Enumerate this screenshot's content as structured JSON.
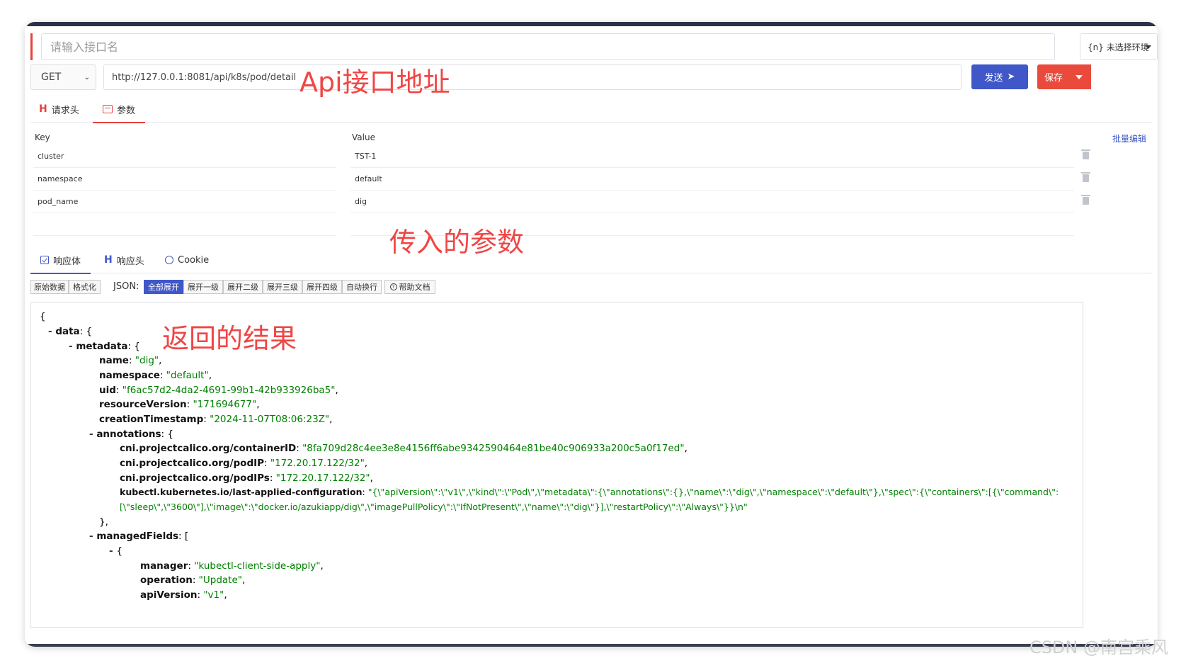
{
  "request": {
    "name_placeholder": "请输入接口名",
    "env_label": "{n} 未选择环境",
    "method": "GET",
    "url": "http://127.0.0.1:8081/api/k8s/pod/detail",
    "send_label": "发送",
    "save_label": "保存"
  },
  "annotations": {
    "api_url": "Api接口地址",
    "params": "传入的参数",
    "result": "返回的结果"
  },
  "request_tabs": [
    {
      "label": "请求头"
    },
    {
      "label": "参数"
    }
  ],
  "params": {
    "key_header": "Key",
    "value_header": "Value",
    "batch_edit": "批量编辑",
    "rows": [
      {
        "key": "cluster",
        "value": "TST-1"
      },
      {
        "key": "namespace",
        "value": "default"
      },
      {
        "key": "pod_name",
        "value": "dig"
      }
    ]
  },
  "response_tabs": [
    {
      "label": "响应体"
    },
    {
      "label": "响应头"
    },
    {
      "label": "Cookie"
    }
  ],
  "toolbar": {
    "raw": "原始数据",
    "format": "格式化",
    "json_label": "JSON:",
    "expand_all": "全部展开",
    "expand_1": "展开一级",
    "expand_2": "展开二级",
    "expand_3": "展开三级",
    "expand_4": "展开四级",
    "wrap": "自动换行",
    "help": "帮助文档"
  },
  "json_view": {
    "open_brace": "{",
    "data_key": "data",
    "metadata_key": "metadata",
    "name_key": "name",
    "name_val": "\"dig\"",
    "namespace_key": "namespace",
    "namespace_val": "\"default\"",
    "uid_key": "uid",
    "uid_val": "\"f6ac57d2-4da2-4691-99b1-42b933926ba5\"",
    "rv_key": "resourceVersion",
    "rv_val": "\"171694677\"",
    "ct_key": "creationTimestamp",
    "ct_val": "\"2024-11-07T08:06:23Z\"",
    "annotations_key": "annotations",
    "cid_key": "cni.projectcalico.org/containerID",
    "cid_val": "\"8fa709d28c4ee3e8e4156ff6abe9342590464e81be40c906933a200c5a0f17ed\"",
    "podip_key": "cni.projectcalico.org/podIP",
    "podip_val": "\"172.20.17.122/32\"",
    "podips_key": "cni.projectcalico.org/podIPs",
    "podips_val": "\"172.20.17.122/32\"",
    "lac_key": "kubectl.kubernetes.io/last-applied-configuration",
    "lac_val_1": "\"{\\\"apiVersion\\\":\\\"v1\\\",\\\"kind\\\":\\\"Pod\\\",\\\"metadata\\\":{\\\"annotations\\\":{},\\\"name\\\":\\\"dig\\\",\\\"namespace\\\":\\\"default\\\"},\\\"spec\\\":{\\\"containers\\\":[{\\\"command\\\":",
    "lac_val_2": "[\\\"sleep\\\",\\\"3600\\\"],\\\"image\\\":\\\"docker.io/azukiapp/dig\\\",\\\"imagePullPolicy\\\":\\\"IfNotPresent\\\",\\\"name\\\":\\\"dig\\\"}],\\\"restartPolicy\\\":\\\"Always\\\"}}\\n\"",
    "close_ann": "},",
    "managed_key": "managedFields",
    "manager_key": "manager",
    "manager_val": "\"kubectl-client-side-apply\"",
    "operation_key": "operation",
    "operation_val": "\"Update\"",
    "apiversion_key": "apiVersion",
    "apiversion_val": "\"v1\""
  },
  "watermark": "CSDN @南宫乘风",
  "colors": {
    "accent_red": "#e8413b",
    "accent_blue": "#4057c9",
    "json_string": "#008000",
    "annotation_red": "#f04646"
  }
}
